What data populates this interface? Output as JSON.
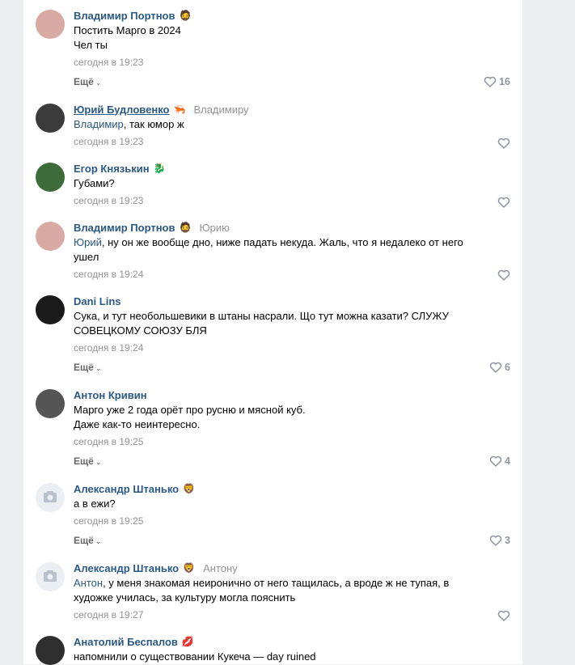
{
  "comments": [
    {
      "author": "Владимир Портнов",
      "author_emoji": "🧔",
      "reply_to": "",
      "lines": [
        "Постить Марго в 2024",
        "Чел ты"
      ],
      "mention": "",
      "date": "сегодня в 19:23",
      "more": "Ещё",
      "likes": "16",
      "avatar_color": "#d9a9a3"
    },
    {
      "author": "Юрий Будловенко",
      "author_emoji": "🦐",
      "reply_to": "Владимиру",
      "lines": [
        ", так юмор ж"
      ],
      "mention": "Владимир",
      "date": "сегодня в 19:23",
      "avatar_color": "#3b3b3b"
    },
    {
      "author": "Егор Князькин",
      "author_emoji": "🐉",
      "reply_to": "",
      "lines": [
        "Губами?"
      ],
      "mention": "",
      "date": "сегодня в 19:23",
      "avatar_color": "#3d6b3a"
    },
    {
      "author": "Владимир Портнов",
      "author_emoji": "🧔",
      "reply_to": "Юрию",
      "lines": [
        ", ну он же вообще дно, ниже падать некуда. Жаль, что я недалеко от него",
        "ушел"
      ],
      "mention": "Юрий",
      "date": "сегодня в 19:24",
      "avatar_color": "#d9a9a3"
    },
    {
      "author": "Dani Lins",
      "author_emoji": "",
      "reply_to": "",
      "lines": [
        "Сука, и тут необольшевики в штаны насрали. Що тут можна казати? СЛУЖУ",
        "СОВЕЦКОМУ СОЮЗУ БЛЯ"
      ],
      "mention": "",
      "date": "сегодня в 19:24",
      "more": "Ещё",
      "likes": "6",
      "avatar_color": "#1a1a1a"
    },
    {
      "author": "Антон Кривин",
      "author_emoji": "",
      "reply_to": "",
      "lines": [
        "Марго уже 2 года орёт про русню и мясной куб.",
        "Даже как-то неинтересно."
      ],
      "mention": "",
      "date": "сегодня в 19:25",
      "more": "Ещё",
      "likes": "4",
      "avatar_color": "#555555"
    },
    {
      "author": "Александр Штанько",
      "author_emoji": "🦁",
      "reply_to": "",
      "lines": [
        "а в ежи?"
      ],
      "mention": "",
      "date": "сегодня в 19:25",
      "more": "Ещё",
      "likes": "3",
      "avatar_color": ""
    },
    {
      "author": "Александр Штанько",
      "author_emoji": "🦁",
      "reply_to": "Антону",
      "lines": [
        ", у меня знакомая неиронично от него тащилась, а вроде ж не тупая, в",
        "художке училась, за культуру могла пояснить"
      ],
      "mention": "Антон",
      "date": "сегодня в 19:27",
      "avatar_color": ""
    },
    {
      "author": "Анатолий Беспалов",
      "author_emoji": "💋",
      "reply_to": "",
      "lines": [
        "напомнили о существовании Кукеча — day ruined"
      ],
      "mention": "",
      "date": "",
      "avatar_color": "#2f2f2f"
    }
  ]
}
